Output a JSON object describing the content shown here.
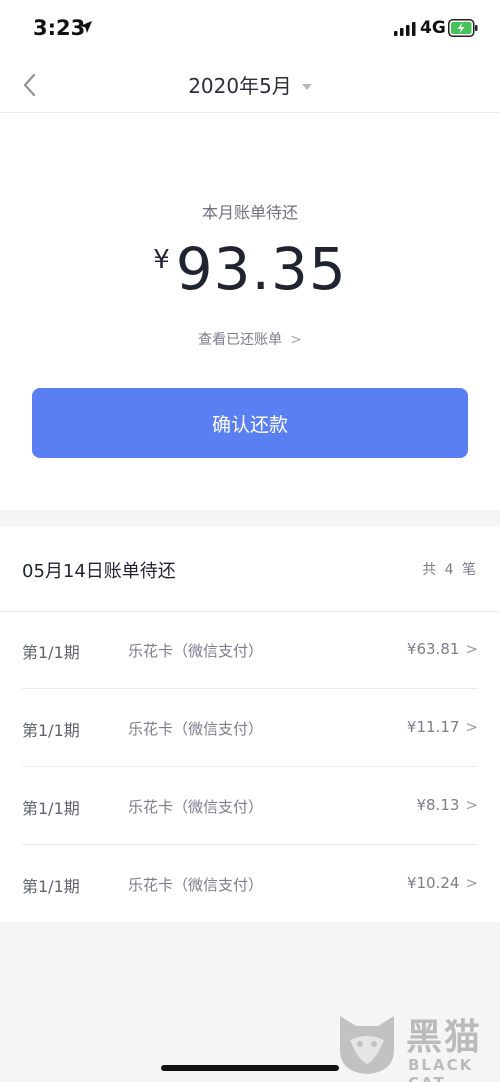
{
  "status_bar": {
    "time": "3:23",
    "location_icon": "location-arrow-icon",
    "signal_icon": "cellular-signal-icon",
    "network": "4G",
    "battery_icon": "battery-charging-icon"
  },
  "nav": {
    "back_icon": "chevron-left-icon",
    "title": "2020年5月",
    "dropdown_icon": "caret-down-icon"
  },
  "summary": {
    "label": "本月账单待还",
    "currency": "¥",
    "amount": "93.35",
    "view_paid": "查看已还账单",
    "view_paid_chevron": ">",
    "confirm_button": "确认还款"
  },
  "bills": {
    "header_title": "05月14日账单待还",
    "header_count": "共 4 笔",
    "rows": [
      {
        "period": "第1/1期",
        "desc": "乐花卡（微信支付）",
        "amount": "¥63.81",
        "chevron": ">"
      },
      {
        "period": "第1/1期",
        "desc": "乐花卡（微信支付）",
        "amount": "¥11.17",
        "chevron": ">"
      },
      {
        "period": "第1/1期",
        "desc": "乐花卡（微信支付）",
        "amount": "¥8.13",
        "chevron": ">"
      },
      {
        "period": "第1/1期",
        "desc": "乐花卡（微信支付）",
        "amount": "¥10.24",
        "chevron": ">"
      }
    ]
  },
  "colors": {
    "primary_button": "#5a7ff2",
    "text_primary": "#1f2430",
    "text_secondary": "#7b7f8c",
    "background": "#f5f5f5"
  },
  "watermark": {
    "logo_icon": "black-cat-logo-icon",
    "cn": "黑猫",
    "en": "BLACK CAT"
  }
}
